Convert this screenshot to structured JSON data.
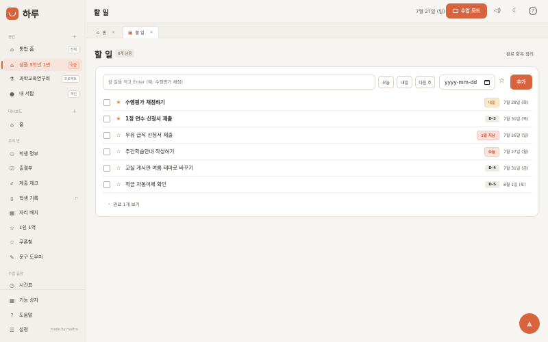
{
  "app": {
    "name": "하루"
  },
  "sidebar": {
    "section_space": "공간",
    "space_items": [
      {
        "label": "통합 홈",
        "tag": "전체"
      },
      {
        "label": "샘플 3학년 1반",
        "tag": "학급"
      },
      {
        "label": "과학교육연구회",
        "tag": "프로젝트"
      },
      {
        "label": "내 서랍",
        "tag": "개인"
      }
    ],
    "section_dashboard": "대시보드",
    "home_label": "홈",
    "section_class": "우리 반",
    "class_items": [
      {
        "label": "학생 명부"
      },
      {
        "label": "출결부"
      },
      {
        "label": "제출 체크"
      },
      {
        "label": "학생 기록"
      },
      {
        "label": "자리 배치"
      },
      {
        "label": "1인 1역"
      },
      {
        "label": "쿠폰함"
      },
      {
        "label": "문구 도우미"
      }
    ],
    "section_schedule": "수업·일정",
    "schedule_items": [
      {
        "label": "시간표"
      }
    ],
    "bottom_items": [
      {
        "label": "기능 상자"
      },
      {
        "label": "도움말"
      },
      {
        "label": "설정"
      }
    ],
    "made_by": "made by mattto"
  },
  "header": {
    "title": "할 일",
    "date": "7월 27일 (일)",
    "class_mode_label": "수업 모드"
  },
  "tabs": [
    {
      "label": "홈"
    },
    {
      "label": "할 일"
    }
  ],
  "main": {
    "title": "할 일",
    "remaining": "6개 남음",
    "clear_done_label": "완료 항목 정리",
    "input_placeholder": "할 일을 적고 Enter (예: 수행평가 채점)",
    "quick_today": "오늘",
    "quick_tomorrow": "내일",
    "quick_next_week": "다음 주",
    "date_placeholder": "yyyy-mm-dd",
    "add_label": "추가",
    "tasks": [
      {
        "title": "수행평가 채점하기",
        "starred": true,
        "bold": true,
        "badge": "내일",
        "badge_type": "tomorrow",
        "date": "7월 28일 (화)"
      },
      {
        "title": "1정 연수 신청서 제출",
        "starred": true,
        "bold": true,
        "badge": "D-3",
        "badge_type": "d",
        "date": "7월 30일 (목)"
      },
      {
        "title": "우유 급식 신청서 제출",
        "starred": false,
        "bold": false,
        "badge": "1일 지남",
        "badge_type": "overdue",
        "date": "7월 26일 (일)"
      },
      {
        "title": "주간학습안내 작성하기",
        "starred": false,
        "bold": false,
        "badge": "오늘",
        "badge_type": "today",
        "date": "7월 27일 (월)"
      },
      {
        "title": "교실 게시판 여름 테마로 바꾸기",
        "starred": false,
        "bold": false,
        "badge": "D-4",
        "badge_type": "d",
        "date": "7월 31일 (금)"
      },
      {
        "title": "적금 자동이체 확인",
        "starred": false,
        "bold": false,
        "badge": "D-5",
        "badge_type": "d",
        "date": "8월 1일 (토)"
      }
    ],
    "show_done_label": "완료 1개 보기"
  },
  "colors": {
    "accent": "#d8643f",
    "background": "#f7f5f2",
    "sidebar": "#f3f0ec"
  },
  "icons": {
    "fab": "flame-icon"
  }
}
